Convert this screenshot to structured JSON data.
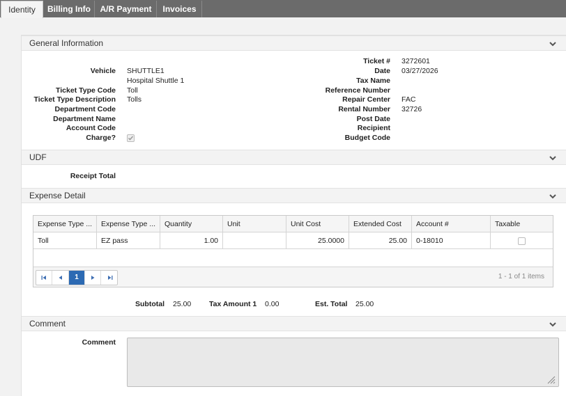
{
  "tabs": [
    {
      "label": "Identity",
      "active": true
    },
    {
      "label": "Billing Info"
    },
    {
      "label": "A/R Payment"
    },
    {
      "label": "Invoices"
    }
  ],
  "general": {
    "title": "General Information",
    "vehicle_label": "Vehicle",
    "vehicle_value": "SHUTTLE1",
    "vehicle_desc": "Hospital Shuttle 1",
    "ticket_type_code_label": "Ticket Type Code",
    "ticket_type_code_value": "Toll",
    "ticket_type_desc_label": "Ticket Type Description",
    "ticket_type_desc_value": "Tolls",
    "dept_code_label": "Department Code",
    "dept_name_label": "Department Name",
    "account_code_label": "Account Code",
    "charge_label": "Charge?",
    "ticket_no_label": "Ticket #",
    "ticket_no_value": "3272601",
    "date_label": "Date",
    "date_value": "03/27/2026",
    "tax_name_label": "Tax Name",
    "ref_no_label": "Reference Number",
    "repair_center_label": "Repair Center",
    "repair_center_value": "FAC",
    "rental_no_label": "Rental Number",
    "rental_no_value": "32726",
    "post_date_label": "Post Date",
    "recipient_label": "Recipient",
    "budget_code_label": "Budget Code"
  },
  "udf": {
    "title": "UDF",
    "receipt_total_label": "Receipt Total"
  },
  "expense": {
    "title": "Expense Detail",
    "columns": [
      "Expense Type ...",
      "Expense Type ...",
      "Quantity",
      "Unit",
      "Unit Cost",
      "Extended Cost",
      "Account #",
      "Taxable"
    ],
    "rows": [
      {
        "type": "Toll",
        "type_desc": "EZ pass",
        "quantity": "1.00",
        "unit": "",
        "unit_cost": "25.0000",
        "extended_cost": "25.00",
        "account": "0-18010"
      }
    ],
    "page": "1",
    "pager_info": "1 - 1 of 1 items",
    "subtotal_label": "Subtotal",
    "subtotal_value": "25.00",
    "tax_label": "Tax Amount 1",
    "tax_value": "0.00",
    "est_total_label": "Est. Total",
    "est_total_value": "25.00"
  },
  "comment": {
    "title": "Comment",
    "label": "Comment",
    "value": ""
  },
  "icons": {
    "chevron": "chevron-down-icon",
    "pager_first": "first-page-icon",
    "pager_prev": "prev-page-icon",
    "pager_next": "next-page-icon",
    "pager_last": "last-page-icon"
  },
  "colors": {
    "tabbar": "#6b6b6b",
    "page_active": "#2c6ab3"
  }
}
